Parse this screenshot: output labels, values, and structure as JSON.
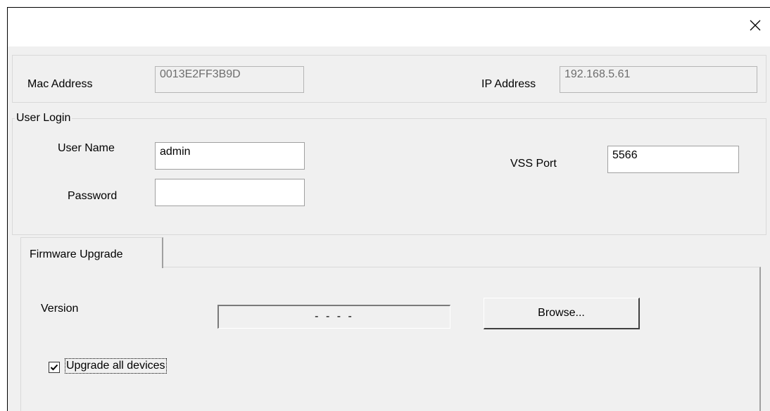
{
  "window": {
    "close_icon": "close-icon"
  },
  "device": {
    "mac_label": "Mac Address",
    "mac_value": "0013E2FF3B9D",
    "ip_label": "IP Address",
    "ip_value": "192.168.5.61"
  },
  "login": {
    "group_label": "User Login",
    "username_label": "User Name",
    "username_value": "admin",
    "password_label": "Password",
    "password_value": "",
    "vss_port_label": "VSS Port",
    "vss_port_value": "5566"
  },
  "firmware": {
    "tab_label": "Firmware Upgrade",
    "version_label": "Version",
    "version_value": "- - - -",
    "browse_label": "Browse...",
    "upgrade_all_label": "Upgrade all devices",
    "upgrade_all_checked": true
  }
}
